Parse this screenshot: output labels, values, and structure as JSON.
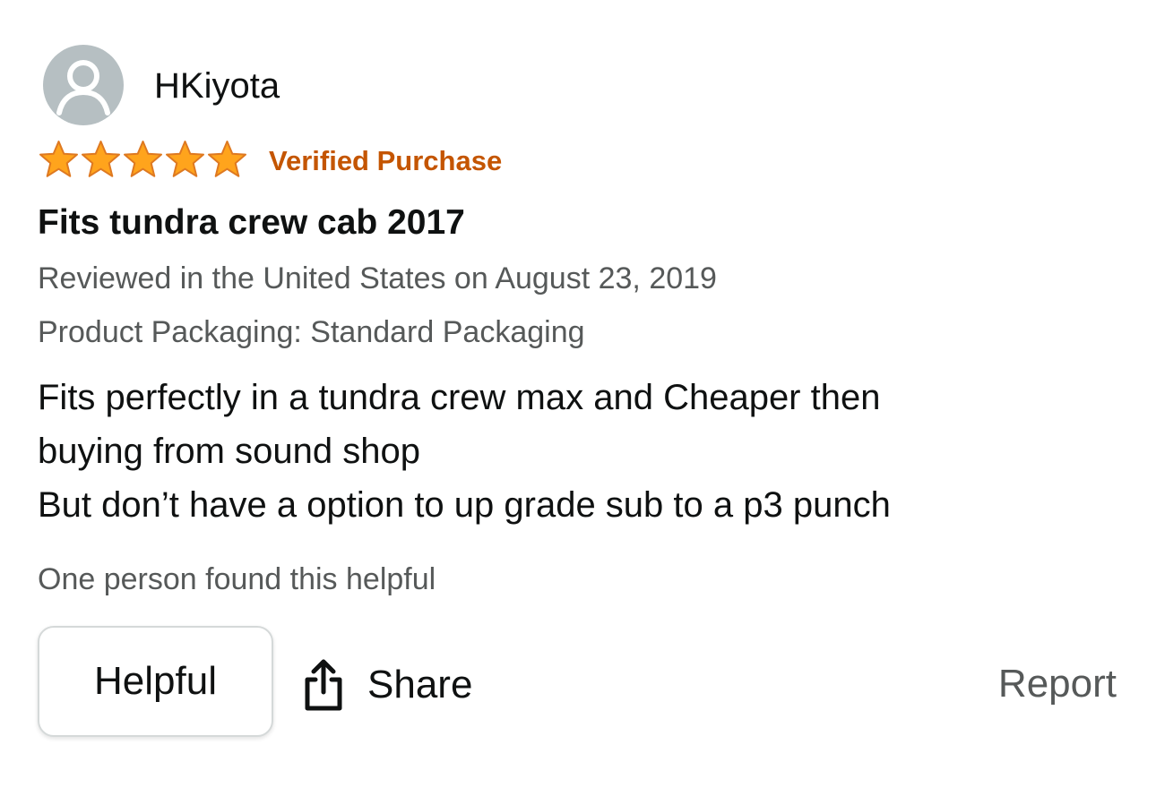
{
  "review": {
    "author": "HKiyota",
    "rating": 5,
    "rating_max": 5,
    "verified_label": "Verified Purchase",
    "title": "Fits tundra crew cab 2017",
    "date_line": "Reviewed in the United States on August 23, 2019",
    "packaging_line": "Product Packaging: Standard Packaging",
    "body_lines": [
      "Fits perfectly in a tundra crew max and Cheaper then",
      "buying from sound shop",
      "But don’t have a option to up grade sub to a p3 punch"
    ],
    "helpful_count_text": "One person found this helpful"
  },
  "actions": {
    "helpful_label": "Helpful",
    "share_label": "Share",
    "report_label": "Report"
  },
  "icons": {
    "avatar": "user-avatar-icon",
    "star": "star-icon",
    "share": "share-icon"
  },
  "colors": {
    "star_fill": "#ffa41c",
    "star_stroke": "#de7921",
    "verified": "#c45500",
    "secondary_text": "#565959",
    "avatar_bg": "#b6bfc2"
  }
}
